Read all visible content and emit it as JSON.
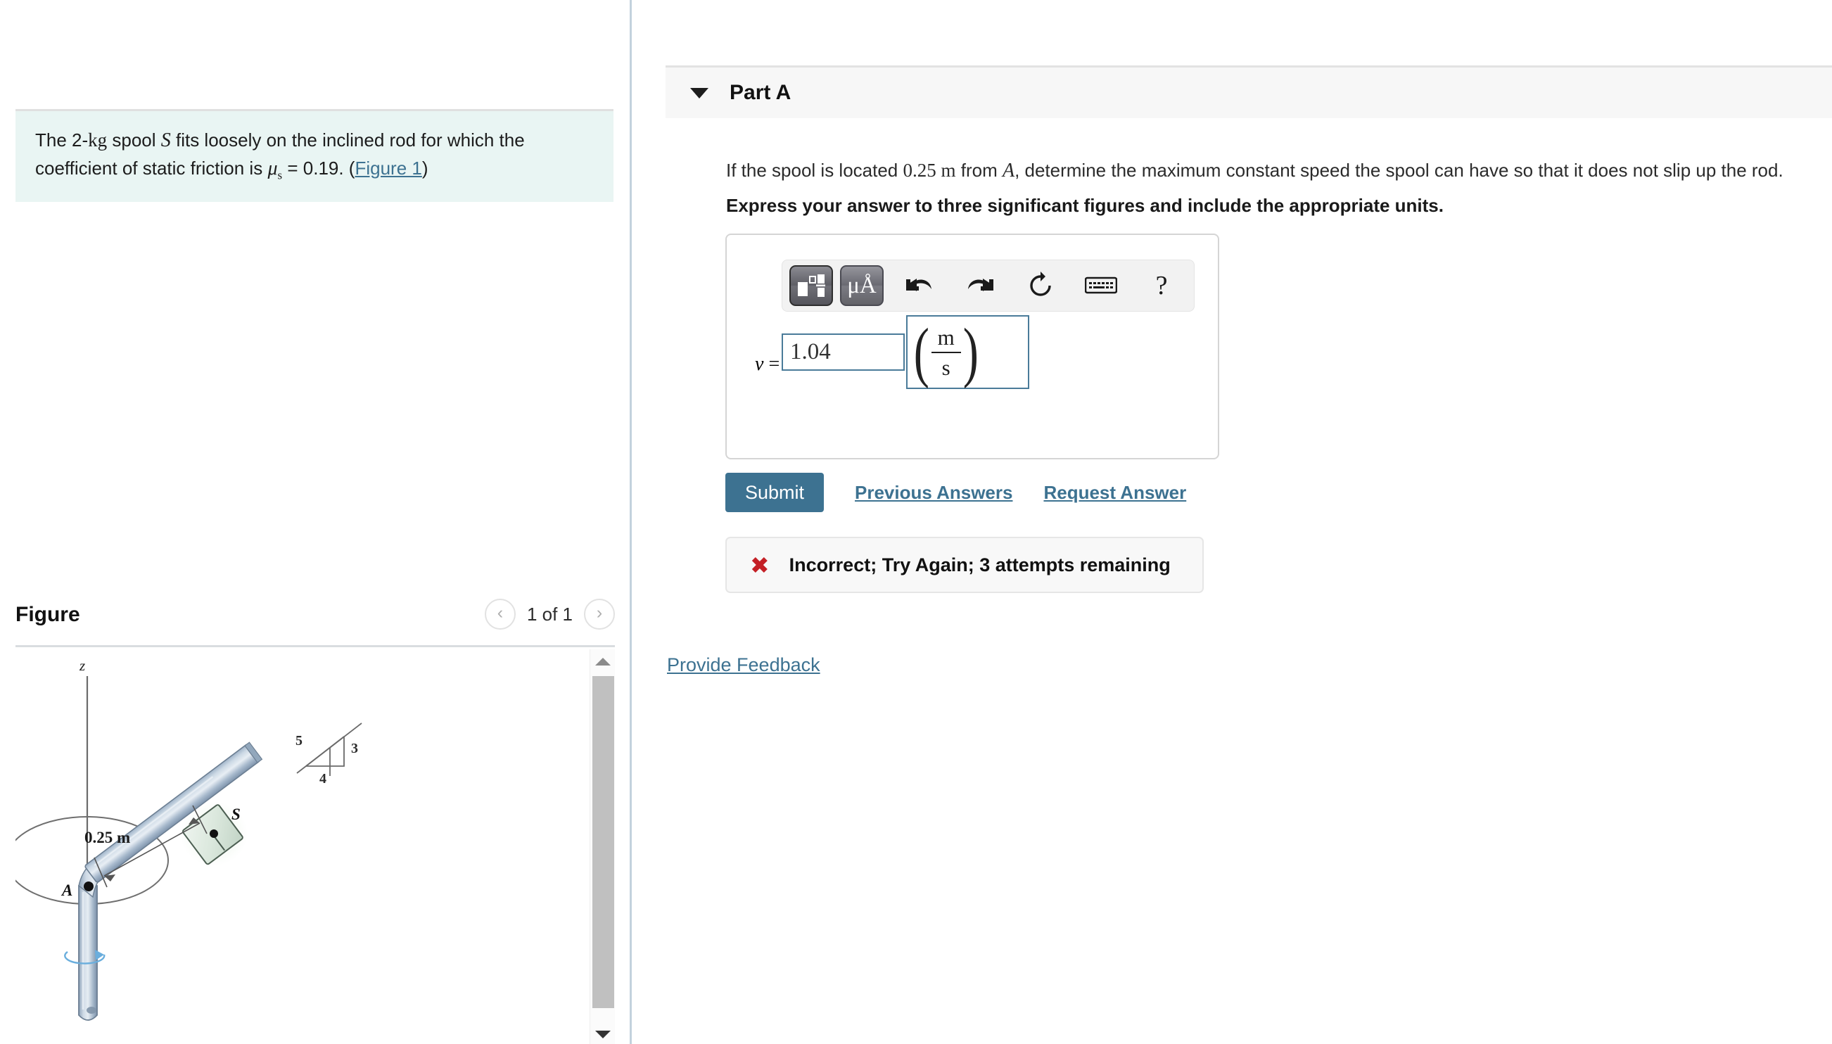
{
  "problem": {
    "text_before_var": "The 2-",
    "unit_kg": "kg",
    "word_spool": " spool ",
    "var_S": "S",
    "text_mid": " fits loosely on the inclined rod for which the coefficient of static friction is ",
    "mu_symbol": "μ",
    "mu_sub": "s",
    "mu_value": " = 0.19. (",
    "figure_link": "Figure 1",
    "text_after": ")"
  },
  "figure": {
    "title": "Figure",
    "counter": "1 of 1",
    "prev_icon": "chevron-left-icon",
    "next_icon": "chevron-right-icon",
    "scrollbar_up_icon": "triangle-up-icon",
    "scrollbar_down_icon": "triangle-down-icon",
    "diagram": {
      "axis_label": "z",
      "point_A": "A",
      "point_S": "S",
      "distance_label": "0.25 m",
      "slope_triangle": {
        "hypotenuse": "5",
        "vertical": "3",
        "horizontal": "4"
      }
    }
  },
  "part": {
    "caret_icon": "triangle-down-icon",
    "title": "Part A",
    "question": "If the spool is located 0.25 m from A, determine the maximum constant speed the spool can have so that it does not slip up the rod.",
    "question_plain_prefix": "If the spool is located ",
    "question_value": "0.25",
    "question_unit": "m",
    "question_mid": " from ",
    "question_var": "A",
    "question_suffix": ", determine the maximum constant speed the spool can have so that it does not slip up the rod.",
    "instruction": "Express your answer to three significant figures and include the appropriate units."
  },
  "answer": {
    "toolbar": [
      {
        "name": "math-template-button",
        "label": ""
      },
      {
        "name": "units-mu-angstrom-button",
        "label": "μÅ"
      },
      {
        "name": "undo-icon",
        "label": "↶"
      },
      {
        "name": "redo-icon",
        "label": "↷"
      },
      {
        "name": "reset-icon",
        "label": "↻"
      },
      {
        "name": "keyboard-icon",
        "label": "⌨"
      },
      {
        "name": "help-icon",
        "label": "?"
      }
    ],
    "variable_label": "v",
    "equals": "=",
    "value": "1.04",
    "placeholder": "",
    "units_numerator": "m",
    "units_denominator": "s",
    "paren_open": "(",
    "paren_close": ")"
  },
  "actions": {
    "submit_label": "Submit",
    "previous_answers_label": "Previous Answers",
    "request_answer_label": "Request Answer"
  },
  "feedback_banner": {
    "icon": "x-mark-icon",
    "message": "Incorrect; Try Again; 3 attempts remaining"
  },
  "provide_feedback_label": "Provide Feedback",
  "colors": {
    "accent_blue": "#3d7291",
    "problem_bg": "#e9f5f3",
    "panel_header_bg": "#f7f7f7",
    "error_red": "#c42026",
    "input_border": "#4a7b99",
    "divider": "#c3d2dd"
  }
}
